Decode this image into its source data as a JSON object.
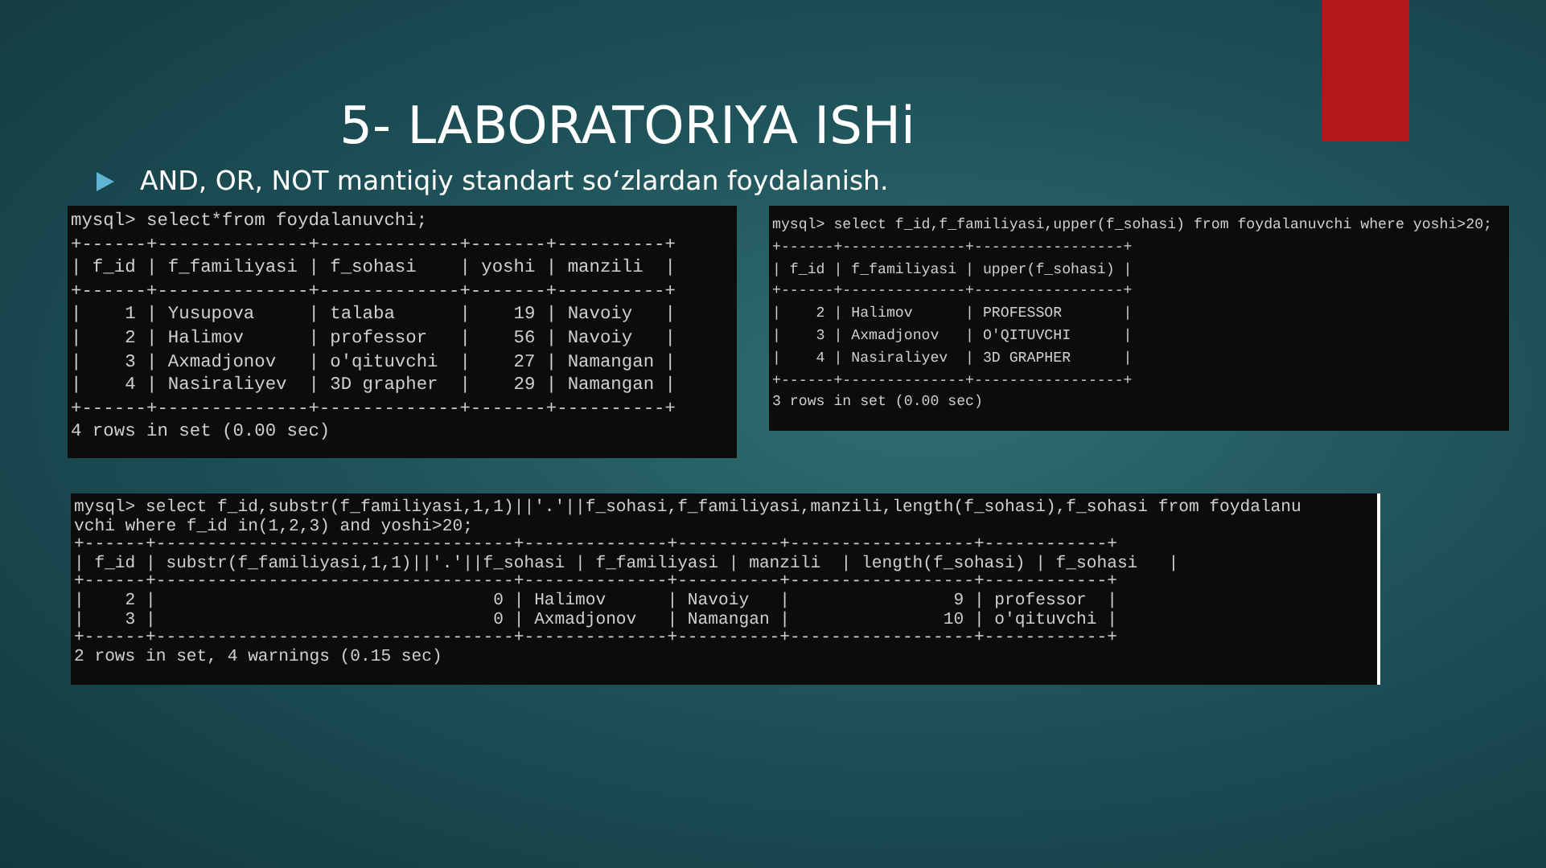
{
  "title": "5- LABORATORIYA ISHi",
  "bullet": "AND, OR, NOT mantiqiy standart so‘zlardan foydalanish.",
  "screenshots": [
    {
      "lines": [
        "mysql> select*from foydalanuvchi;",
        "+------+--------------+-------------+-------+----------+",
        "| f_id | f_familiyasi | f_sohasi    | yoshi | manzili  |",
        "+------+--------------+-------------+-------+----------+",
        "|    1 | Yusupova     | talaba      |    19 | Navoiy   |",
        "|    2 | Halimov      | professor   |    56 | Navoiy   |",
        "|    3 | Axmadjonov   | o'qituvchi  |    27 | Namangan |",
        "|    4 | Nasiraliyev  | 3D grapher  |    29 | Namangan |",
        "+------+--------------+-------------+-------+----------+",
        "4 rows in set (0.00 sec)"
      ]
    },
    {
      "lines": [
        "mysql> select f_id,f_familiyasi,upper(f_sohasi) from foydalanuvchi where yoshi>20;",
        "+------+--------------+-----------------+",
        "| f_id | f_familiyasi | upper(f_sohasi) |",
        "+------+--------------+-----------------+",
        "|    2 | Halimov      | PROFESSOR       |",
        "|    3 | Axmadjonov   | O'QITUVCHI      |",
        "|    4 | Nasiraliyev  | 3D GRAPHER      |",
        "+------+--------------+-----------------+",
        "3 rows in set (0.00 sec)"
      ]
    },
    {
      "lines": [
        "mysql> select f_id,substr(f_familiyasi,1,1)||'.'||f_sohasi,f_familiyasi,manzili,length(f_sohasi),f_sohasi from foydalanu",
        "vchi where f_id in(1,2,3) and yoshi>20;",
        "+------+-----------------------------------+--------------+----------+------------------+------------+",
        "| f_id | substr(f_familiyasi,1,1)||'.'||f_sohasi | f_familiyasi | manzili  | length(f_sohasi) | f_sohasi   |",
        "+------+-----------------------------------+--------------+----------+------------------+------------+",
        "|    2 |                                 0 | Halimov      | Navoiy   |                9 | professor  |",
        "|    3 |                                 0 | Axmadjonov   | Namangan |               10 | o'qituvchi |",
        "+------+-----------------------------------+--------------+----------+------------------+------------+",
        "2 rows in set, 4 warnings (0.15 sec)"
      ]
    }
  ]
}
